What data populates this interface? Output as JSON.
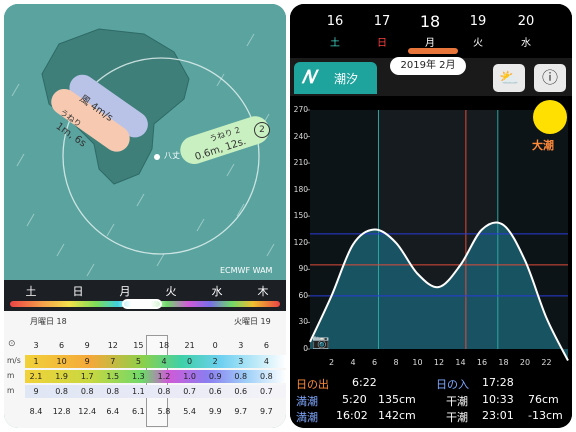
{
  "left": {
    "map": {
      "source_label": "ECMWF WAM",
      "wind_label": "風 4m/s",
      "swell1_title": "うねり",
      "swell1_value": "1m, 6s",
      "swell2_title": "うねり 2",
      "swell2_value": "0.6m, 12s.",
      "swell2_badge": "2",
      "place_label": "八丈",
      "colors": {
        "sea": "#5aa39f",
        "land": "#3e7f7a",
        "wind_tag": "#b9c3e8",
        "swell1_tag": "#f6c9b0",
        "swell2_tag": "#c9f0c0"
      }
    },
    "days": [
      "土",
      "日",
      "月",
      "火",
      "水",
      "木"
    ],
    "table": {
      "date_left": "月曜日 18",
      "date_right": "火曜日 19",
      "hours": [
        "3",
        "6",
        "9",
        "12",
        "15",
        "18",
        "21",
        "0",
        "3",
        "6"
      ],
      "row_labels": [
        "m/s",
        "m",
        "m"
      ],
      "wind": [
        "1",
        "10",
        "9",
        "7",
        "5",
        "4",
        "0",
        "2",
        "3",
        "4"
      ],
      "wave": [
        "2.1",
        "1.9",
        "1.7",
        "1.5",
        "1.3",
        "1.2",
        "1.0",
        "0.9",
        "0.8",
        "0.8"
      ],
      "swell": [
        "9",
        "0.8",
        "0.8",
        "0.8",
        "1.1",
        "0.8",
        "0.7",
        "0.6",
        "0.6",
        "0.7"
      ],
      "period": [
        "8.4",
        "12.8",
        "12.4",
        "6.4",
        "6.1",
        "5.8",
        "5.4",
        "9.9",
        "9.7",
        "9.7"
      ]
    }
  },
  "right": {
    "dates": [
      {
        "num": "16",
        "wk": "土",
        "color": "#3fd0c0"
      },
      {
        "num": "17",
        "wk": "日",
        "color": "#ff4040"
      },
      {
        "num": "18",
        "wk": "月",
        "color": "#ffffff"
      },
      {
        "num": "19",
        "wk": "火",
        "color": "#ffffff"
      },
      {
        "num": "20",
        "wk": "水",
        "color": "#ffffff"
      }
    ],
    "tab_label": "潮汐",
    "month_label": "2019年 2月",
    "tide_type": "大潮",
    "chart_data": {
      "type": "line",
      "x": [
        0,
        2,
        4,
        6,
        8,
        10,
        12,
        14,
        16,
        18,
        20,
        22,
        24
      ],
      "values": [
        8,
        60,
        118,
        135,
        120,
        85,
        70,
        95,
        135,
        140,
        100,
        35,
        -13
      ],
      "xticks": [
        "2",
        "4",
        "6",
        "8",
        "10",
        "12",
        "14",
        "16",
        "18",
        "20",
        "22"
      ],
      "yticks": [
        "270",
        "240",
        "210",
        "180",
        "150",
        "120",
        "90",
        "60",
        "30",
        "0"
      ],
      "ylim": [
        0,
        270
      ],
      "xlim": [
        0,
        24
      ]
    },
    "sun": {
      "rise_label": "日の出",
      "rise": "6:22",
      "set_label": "日の入",
      "set": "17:28"
    },
    "tides": {
      "high_label": "満潮",
      "low_label": "干潮",
      "high1_time": "5:20",
      "high1_height": "135cm",
      "high2_time": "16:02",
      "high2_height": "142cm",
      "low1_time": "10:33",
      "low1_height": "76cm",
      "low2_time": "23:01",
      "low2_height": "-13cm"
    }
  }
}
